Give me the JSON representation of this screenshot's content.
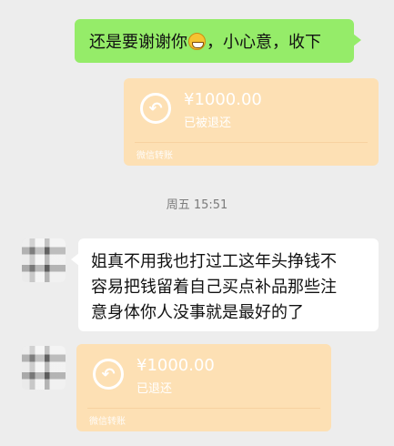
{
  "messages": {
    "outgoing_text_before_emoji": "还是要谢谢你",
    "outgoing_text_after_emoji": "，小心意，收下",
    "outgoing_emoji": "grin-emoji-icon",
    "transfer_out": {
      "amount": "¥1000.00",
      "status": "已被退还",
      "footer": "微信转账",
      "icon": "return-arrow-icon"
    },
    "timestamp": "周五 15:51",
    "incoming_text_lines": [
      "姐真不用我也打过工这年头挣钱不",
      "容易把钱留着自己买点补品那些注",
      "意身体你人没事就是最好的了"
    ],
    "transfer_in": {
      "amount": "¥1000.00",
      "status": "已退还",
      "footer": "微信转账",
      "icon": "return-arrow-icon"
    }
  },
  "colors": {
    "chat_background": "#ededed",
    "outgoing_bubble": "#95ec69",
    "incoming_bubble": "#ffffff",
    "transfer_card": "#fde0b4"
  }
}
